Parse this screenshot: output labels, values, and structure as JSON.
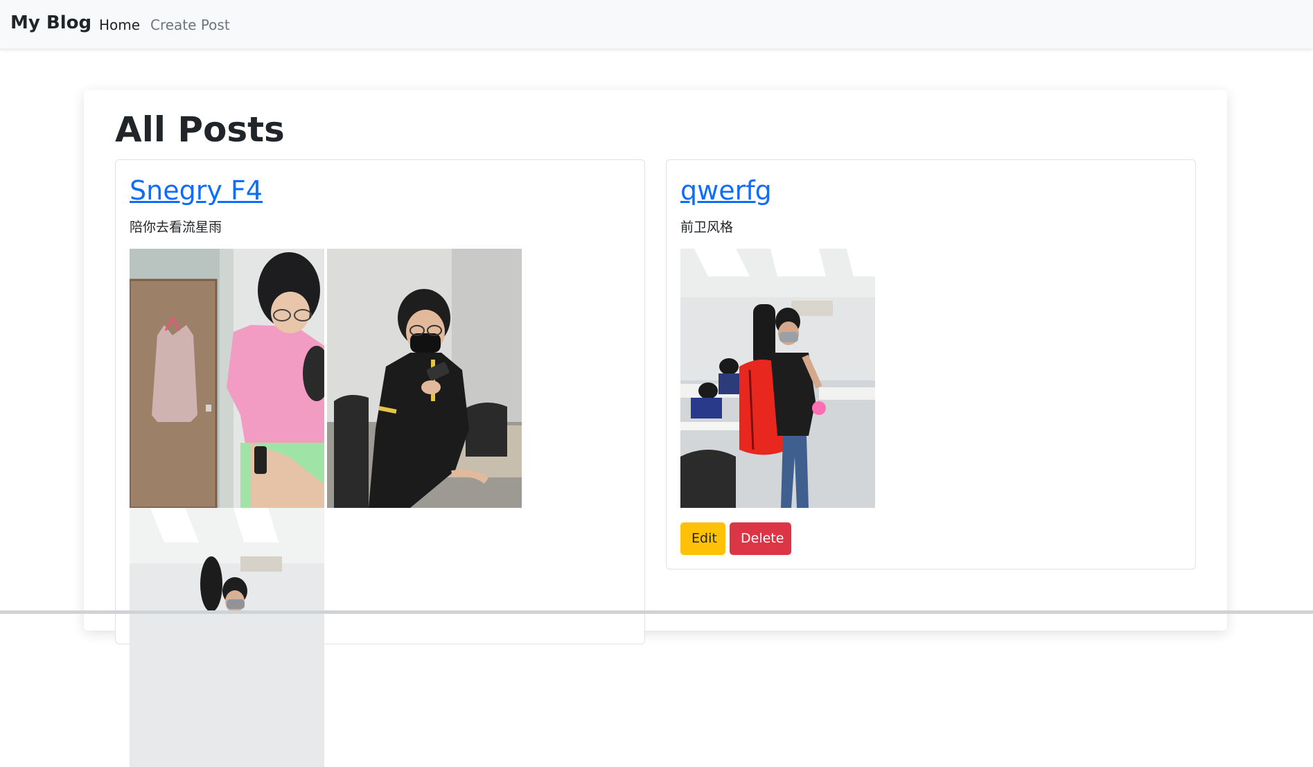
{
  "navbar": {
    "brand": "My Blog",
    "links": [
      {
        "label": "Home",
        "active": true
      },
      {
        "label": "Create Post",
        "active": false
      }
    ]
  },
  "page": {
    "title": "All Posts"
  },
  "posts": [
    {
      "title": "Snegry F4",
      "body": "陪你去看流星雨",
      "image_count_visible": 3,
      "image_subjects": [
        "fitting-room-photo",
        "student-with-phone-photo",
        "classroom-photo"
      ]
    },
    {
      "title": "qwerfg",
      "body": "前卫风格",
      "image_count_visible": 1,
      "image_subjects": [
        "student-with-red-bag-photo"
      ],
      "actions": {
        "edit_label": "Edit",
        "delete_label": "Delete"
      }
    }
  ],
  "colors": {
    "link": "#0d6efd",
    "edit": "#ffc107",
    "delete": "#dc3545",
    "navbar_bg": "#f8f9fa"
  }
}
